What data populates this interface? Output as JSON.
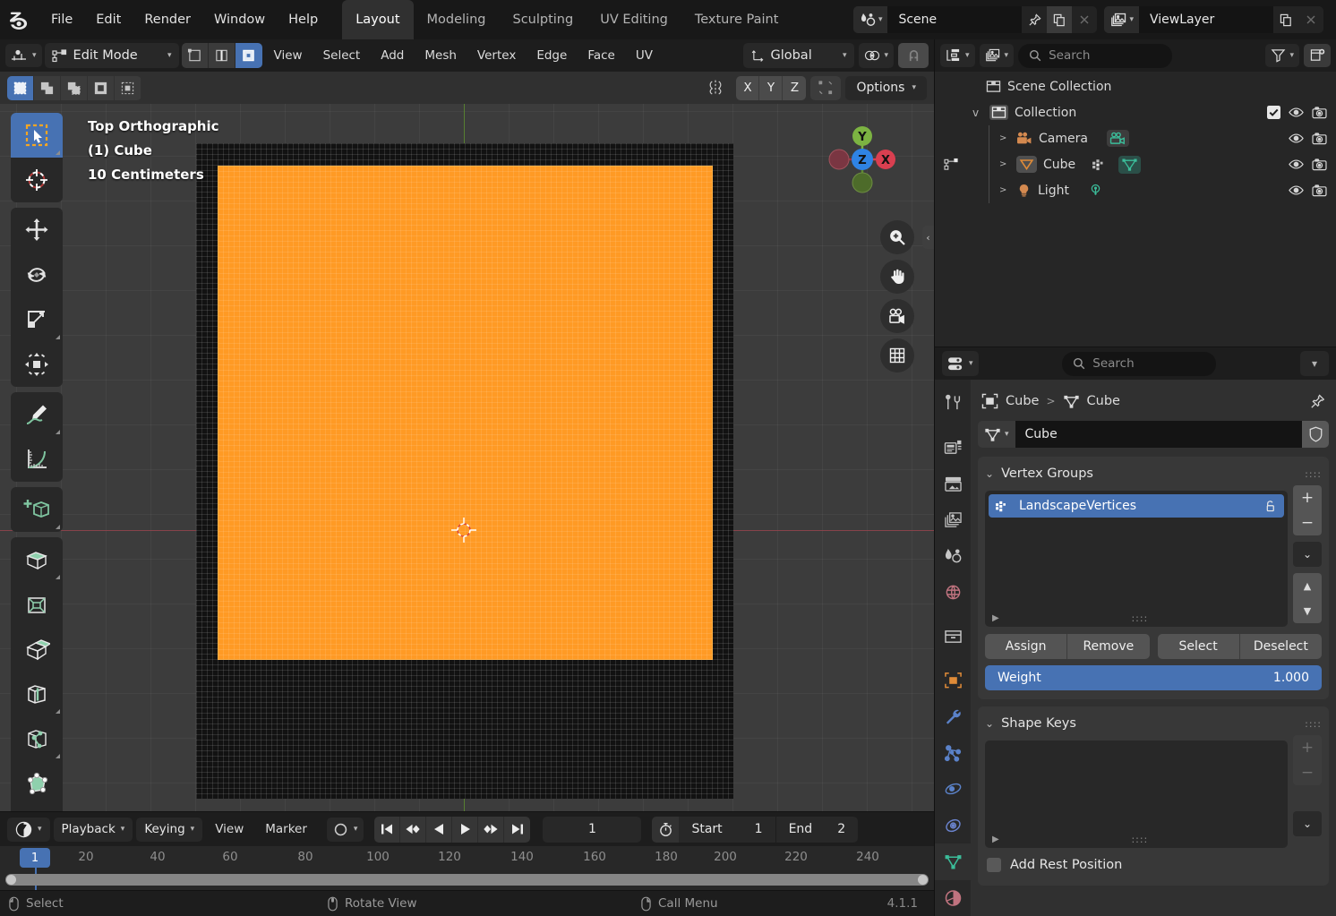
{
  "app": {
    "version": "4.1.1"
  },
  "topbar": {
    "logo_icon": "blender-logo-icon",
    "menus": [
      "File",
      "Edit",
      "Render",
      "Window",
      "Help"
    ],
    "workspace_tabs": [
      {
        "label": "Layout",
        "active": true
      },
      {
        "label": "Modeling",
        "active": false
      },
      {
        "label": "Sculpting",
        "active": false
      },
      {
        "label": "UV Editing",
        "active": false
      },
      {
        "label": "Texture Paint",
        "active": false
      }
    ],
    "scene": {
      "icon": "scene-icon",
      "name": "Scene",
      "pin_icon": "pin-icon",
      "copy_icon": "new-scene-icon",
      "close_icon": "close-icon"
    },
    "viewlayer": {
      "icon": "viewlayer-icon",
      "name": "ViewLayer",
      "copy_icon": "new-viewlayer-icon",
      "close_icon": "close-icon"
    }
  },
  "viewport_header": {
    "editor_type_icon": "editor-type-icon",
    "mode": {
      "icon": "edit-mode-icon",
      "label": "Edit Mode"
    },
    "mesh_select_modes": [
      {
        "name": "vertex-select-mode",
        "active": false
      },
      {
        "name": "edge-select-mode",
        "active": false
      },
      {
        "name": "face-select-mode",
        "active": true
      }
    ],
    "menus": [
      "View",
      "Select",
      "Add",
      "Mesh",
      "Vertex",
      "Edge",
      "Face",
      "UV"
    ],
    "transform_orientation": {
      "icon": "orientation-icon",
      "label": "Global"
    },
    "pivot_icon": "pivot-point-icon",
    "snap_icon": "snap-magnet-icon"
  },
  "viewport_subheader": {
    "select_tool_modes": [
      {
        "name": "select-set-mode",
        "active": true
      },
      {
        "name": "select-extend-mode",
        "active": false
      },
      {
        "name": "select-subtract-mode",
        "active": false
      },
      {
        "name": "select-invert-mode",
        "active": false
      },
      {
        "name": "select-intersect-mode",
        "active": false
      }
    ],
    "mirror_icon": "mirror-icon",
    "mirror_axes": [
      "X",
      "Y",
      "Z"
    ],
    "proportional_icon": "proportional-editing-icon",
    "options_label": "Options"
  },
  "viewport": {
    "overlay_lines": [
      "Top Orthographic",
      "(1) Cube",
      "10 Centimeters"
    ],
    "gizmo_axes": [
      {
        "label": "Y",
        "name": "gizmo-axis-y",
        "color": "#7cb342"
      },
      {
        "label": "Z",
        "name": "gizmo-axis-z",
        "color": "#2f83e3"
      },
      {
        "label": "X",
        "name": "gizmo-axis-x",
        "color": "#d93f50"
      }
    ],
    "nav_buttons": [
      "zoom-icon",
      "pan-hand-icon",
      "camera-view-icon",
      "toggle-ortho-grid-icon"
    ],
    "sidebar_toggle_icon": "chevron-left-icon",
    "mesh_selected_color": "#ff9a24",
    "mesh_unselected_color": "#121212",
    "tools": [
      {
        "name": "tweak-select-tool",
        "active": true,
        "icon": "cursor-box-select-icon"
      },
      {
        "name": "cursor-tool",
        "active": false,
        "icon": "3d-cursor-icon"
      },
      {
        "name": "move-tool",
        "active": false,
        "icon": "move-arrows-icon"
      },
      {
        "name": "rotate-tool",
        "active": false,
        "icon": "rotate-icon"
      },
      {
        "name": "scale-tool",
        "active": false,
        "icon": "scale-icon"
      },
      {
        "name": "transform-tool",
        "active": false,
        "icon": "transform-icon"
      },
      {
        "name": "annotate-tool",
        "active": false,
        "icon": "pencil-annotate-icon"
      },
      {
        "name": "measure-tool",
        "active": false,
        "icon": "ruler-measure-icon"
      },
      {
        "name": "add-cube-tool",
        "active": false,
        "icon": "add-cube-icon"
      },
      {
        "name": "extrude-region-tool",
        "active": false,
        "icon": "extrude-region-icon"
      },
      {
        "name": "inset-faces-tool",
        "active": false,
        "icon": "inset-faces-icon"
      },
      {
        "name": "bevel-tool",
        "active": false,
        "icon": "bevel-icon"
      },
      {
        "name": "loop-cut-tool",
        "active": false,
        "icon": "loop-cut-icon"
      },
      {
        "name": "knife-tool",
        "active": false,
        "icon": "knife-icon"
      },
      {
        "name": "poly-build-tool",
        "active": false,
        "icon": "poly-build-icon"
      },
      {
        "name": "spin-tool",
        "active": false,
        "icon": "spin-icon"
      }
    ]
  },
  "outliner": {
    "display_mode_icon": "outliner-display-mode-icon",
    "filter_id_icon": "outliner-id-type-icon",
    "search": {
      "placeholder": "Search",
      "value": ""
    },
    "filter_icon": "funnel-filter-icon",
    "new_collection_icon": "new-collection-icon",
    "rows": [
      {
        "label": "Scene Collection",
        "icon": "collection-icon",
        "indent": 0,
        "expand": "",
        "checkbox": false,
        "eye": false,
        "camera": false
      },
      {
        "label": "Collection",
        "icon": "collection-icon",
        "indent": 1,
        "expand": "v",
        "checkbox": true,
        "eye": true,
        "camera": true
      },
      {
        "label": "Camera",
        "icon": "camera-object-icon",
        "indent": 2,
        "expand": ">",
        "data_icon": "camera-data-icon",
        "checkbox": false,
        "eye": true,
        "camera": true
      },
      {
        "label": "Cube",
        "icon": "mesh-object-icon",
        "indent": 2,
        "expand": ">",
        "data_icon": "mesh-data-icon",
        "extra_icon": "vertex-group-icon",
        "checkbox": false,
        "eye": true,
        "camera": true
      },
      {
        "label": "Light",
        "icon": "light-object-icon",
        "indent": 2,
        "expand": ">",
        "data_icon": "light-data-icon",
        "checkbox": false,
        "eye": true,
        "camera": true
      }
    ]
  },
  "properties": {
    "editor_type_icon": "properties-editor-icon",
    "search": {
      "placeholder": "Search",
      "value": ""
    },
    "expand_icon": "chevron-down-icon",
    "tabs": [
      {
        "name": "tool-tab",
        "icon": "tool-screwdriver-wrench-icon",
        "active": false
      },
      {
        "name": "render-tab",
        "icon": "render-camera-icon",
        "active": false
      },
      {
        "name": "output-tab",
        "icon": "output-printer-icon",
        "active": false
      },
      {
        "name": "view-layer-tab",
        "icon": "view-layer-images-icon",
        "active": false
      },
      {
        "name": "scene-tab",
        "icon": "scene-cone-icon",
        "active": false
      },
      {
        "name": "world-tab",
        "icon": "world-globe-icon",
        "active": false
      },
      {
        "name": "collection-tab",
        "icon": "collection-box-icon",
        "active": false
      },
      {
        "name": "object-tab",
        "icon": "object-square-icon",
        "active": false
      },
      {
        "name": "modifier-tab",
        "icon": "modifier-wrench-icon",
        "active": false
      },
      {
        "name": "particles-tab",
        "icon": "particles-icon",
        "active": false
      },
      {
        "name": "physics-tab",
        "icon": "physics-orbit-icon",
        "active": false
      },
      {
        "name": "constraints-tab",
        "icon": "constraints-icon",
        "active": false
      },
      {
        "name": "data-tab",
        "icon": "mesh-data-triangle-icon",
        "active": true
      },
      {
        "name": "material-tab",
        "icon": "material-sphere-icon",
        "active": false
      }
    ],
    "breadcrumb": {
      "object_icon": "object-square-icon",
      "object": "Cube",
      "separator": ">",
      "data_icon": "mesh-data-triangle-icon",
      "data": "Cube",
      "pin_icon": "pin-icon"
    },
    "id_block": {
      "icon": "mesh-data-triangle-icon",
      "name": "Cube",
      "shield_icon": "fake-user-shield-icon"
    },
    "vertex_groups": {
      "title": "Vertex Groups",
      "grip_icon": "panel-grip-icon",
      "items": [
        {
          "label": "LandscapeVertices",
          "icon": "vertex-group-icon",
          "lock_icon": "unlock-icon",
          "selected": true
        }
      ],
      "add_icon": "+",
      "remove_icon": "−",
      "specials_icon": "chevron-down-icon",
      "move_up_icon": "▲",
      "move_down_icon": "▼",
      "buttons": [
        "Assign",
        "Remove",
        "Select",
        "Deselect"
      ],
      "weight": {
        "label": "Weight",
        "value": "1.000"
      }
    },
    "shape_keys": {
      "title": "Shape Keys",
      "grip_icon": "panel-grip-icon",
      "items": [],
      "add_icon": "+",
      "remove_icon": "−",
      "specials_icon": "chevron-down-icon",
      "add_rest_position": {
        "label": "Add Rest Position",
        "checked": false
      }
    }
  },
  "timeline": {
    "editor_type_icon": "timeline-editor-icon",
    "menus": [
      {
        "label": "Playback",
        "dropdown": true
      },
      {
        "label": "Keying",
        "dropdown": true
      },
      {
        "label": "View",
        "dropdown": false
      },
      {
        "label": "Marker",
        "dropdown": false
      }
    ],
    "auto_key_icon": "record-circle-icon",
    "transport": [
      "jump-to-start-icon",
      "jump-prev-keyframe-icon",
      "play-reverse-icon",
      "play-icon",
      "jump-next-keyframe-icon",
      "jump-to-end-icon"
    ],
    "current_frame": "1",
    "timer_icon": "stopwatch-icon",
    "start": {
      "label": "Start",
      "value": "1"
    },
    "end": {
      "label": "End",
      "value": "2"
    },
    "ruler_ticks": [
      "20",
      "40",
      "60",
      "80",
      "100",
      "120",
      "140",
      "160",
      "180",
      "200",
      "220",
      "240"
    ],
    "playhead_label": "1"
  },
  "statusbar": {
    "hints": [
      {
        "icon": "mouse-left-icon",
        "label": "Select"
      },
      {
        "icon": "mouse-middle-icon",
        "label": "Rotate View"
      },
      {
        "icon": "mouse-right-icon",
        "label": "Call Menu"
      }
    ]
  }
}
